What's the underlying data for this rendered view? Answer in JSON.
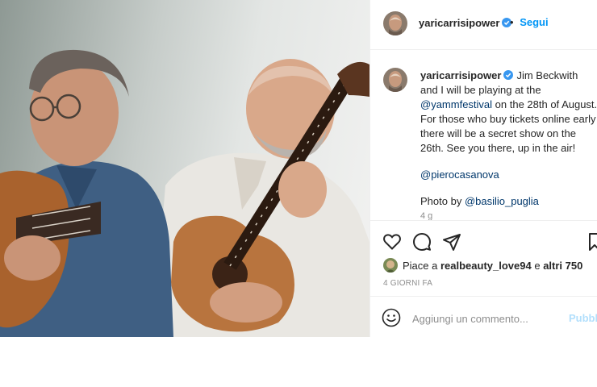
{
  "post": {
    "username": "yaricarrisipower",
    "follow_separator": "•",
    "follow_label": "Segui",
    "verified_icon": "verified-badge-icon",
    "accent_color": "#0095f6",
    "link_color": "#00376b"
  },
  "caption": {
    "text_1": "Jim Beckwith and I will be playing at the ",
    "mention_festival": "@yammfestival",
    "text_2": " on the 28th of August. For those who buy tickets online early there will be a secret show on the 26th. See you there, up in the air!",
    "mention_piero": "@pierocasanova",
    "photo_by": "Photo by ",
    "mention_basilio": "@basilio_puglia",
    "time_ago": "4 g"
  },
  "actions": {
    "icons": [
      "heart-icon",
      "comment-icon",
      "share-icon",
      "bookmark-icon"
    ]
  },
  "likes": {
    "prefix": "Piace a ",
    "user": "realbeauty_love94",
    "conjunction": " e ",
    "others": "altri 750"
  },
  "date": "4 GIORNI FA",
  "comment": {
    "placeholder": "Aggiungi un commento...",
    "publish_label": "Pubblica"
  }
}
